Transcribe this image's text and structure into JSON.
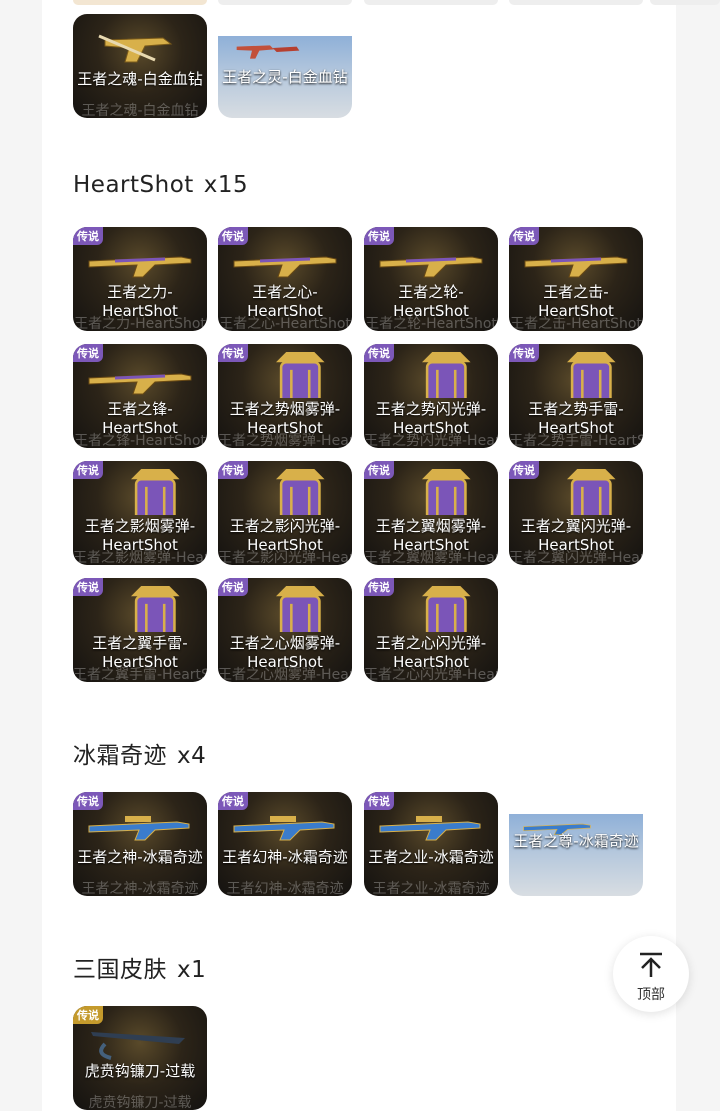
{
  "sections": [
    {
      "cards": [
        {
          "name": "王者之魂-白金血钻",
          "ghost": "王者之魂-白金血钻"
        },
        {
          "name": "王者之灵-白金血钻",
          "ghost": ""
        }
      ]
    },
    {
      "title": "HeartShot",
      "count": "x15",
      "cards": [
        {
          "badge": "传说",
          "name": "王者之力-HeartShot",
          "ghost": "王者之力-HeartShot"
        },
        {
          "badge": "传说",
          "name": "王者之心-HeartShot",
          "ghost": "王者之心-HeartShot"
        },
        {
          "badge": "传说",
          "name": "王者之轮-HeartShot",
          "ghost": "王者之轮-HeartShot"
        },
        {
          "badge": "传说",
          "name": "王者之击-HeartShot",
          "ghost": "王者之击-HeartShot"
        },
        {
          "badge": "传说",
          "name": "王者之锋-HeartShot",
          "ghost": "王者之锋-HeartShot"
        },
        {
          "badge": "传说",
          "name": "王者之势烟雾弹-HeartShot",
          "ghost": "王者之势烟雾弹-HeartShot"
        },
        {
          "badge": "传说",
          "name": "王者之势闪光弹-HeartShot",
          "ghost": "王者之势闪光弹-HeartShot"
        },
        {
          "badge": "传说",
          "name": "王者之势手雷-HeartShot",
          "ghost": "王者之势手雷-HeartShot"
        },
        {
          "badge": "传说",
          "name": "王者之影烟雾弹-HeartShot",
          "ghost": "王者之影烟雾弹-HeartShot"
        },
        {
          "badge": "传说",
          "name": "王者之影闪光弹-HeartShot",
          "ghost": "王者之影闪光弹-HeartShot"
        },
        {
          "badge": "传说",
          "name": "王者之翼烟雾弹-HeartShot",
          "ghost": "王者之翼烟雾弹-HeartShot"
        },
        {
          "badge": "传说",
          "name": "王者之翼闪光弹-HeartShot",
          "ghost": "王者之翼闪光弹-HeartShot"
        },
        {
          "badge": "传说",
          "name": "王者之翼手雷-HeartShot",
          "ghost": "王者之翼手雷-HeartShot"
        },
        {
          "badge": "传说",
          "name": "王者之心烟雾弹-HeartShot",
          "ghost": "王者之心烟雾弹-HeartShot"
        },
        {
          "badge": "传说",
          "name": "王者之心闪光弹-HeartShot",
          "ghost": "王者之心闪光弹-HeartShot"
        }
      ]
    },
    {
      "title": "冰霜奇迹",
      "count": "x4",
      "cards": [
        {
          "badge": "传说",
          "name": "王者之神-冰霜奇迹",
          "ghost": "王者之神-冰霜奇迹"
        },
        {
          "badge": "传说",
          "name": "王者幻神-冰霜奇迹",
          "ghost": "王者幻神-冰霜奇迹"
        },
        {
          "badge": "传说",
          "name": "王者之业-冰霜奇迹",
          "ghost": "王者之业-冰霜奇迹"
        },
        {
          "name": "王者之尊-冰霜奇迹",
          "ghost": ""
        }
      ]
    },
    {
      "title": "三国皮肤",
      "count": "x1",
      "cards": [
        {
          "badge": "传说",
          "name": "虎贲钩镰刀-过载",
          "ghost": "虎贲钩镰刀-过载"
        }
      ]
    }
  ],
  "back_to_top": {
    "label": "顶部",
    "icon": "arrow-up-to-top-icon"
  },
  "colors": {
    "badge_purple": "#7c58b8",
    "card_dark": "#141210",
    "gold": "#d8b04a"
  }
}
